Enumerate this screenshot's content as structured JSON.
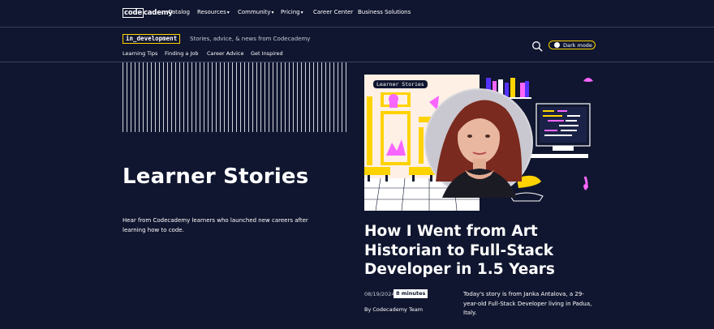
{
  "topnav": {
    "logo_code": "code",
    "logo_cademy": "cademy",
    "items": [
      {
        "label": "Catalog",
        "dropdown": false
      },
      {
        "label": "Resources",
        "dropdown": true
      },
      {
        "label": "Community",
        "dropdown": true
      },
      {
        "label": "Pricing",
        "dropdown": true
      },
      {
        "label": "Career Center",
        "dropdown": false
      },
      {
        "label": "Business Solutions",
        "dropdown": false
      }
    ],
    "caret": "▾"
  },
  "subheader": {
    "brand": "in_development",
    "tagline": "Stories, advice, & news from Codecademy",
    "links": [
      "Learning Tips",
      "Finding a Job",
      "Career Advice",
      "Get Inspired"
    ],
    "dark_mode_label": "Dark mode",
    "search_icon": "search-icon"
  },
  "hero": {
    "title": "Learner Stories",
    "description": "Hear from Codecademy learners who launched new careers after learning how to code."
  },
  "feature": {
    "image_badge": "Learner Stories",
    "title": "How I Went from Art Historian to Full-Stack Developer in 1.5 Years",
    "date": "08/19/2024",
    "read_time": "8 minutes",
    "author": "By Codecademy Team",
    "summary": "Today's story is from Janka Antalova, a 29-year-old Full-Stack Developer living in Padua, Italy."
  },
  "colors": {
    "background": "#10162f",
    "accent_yellow": "#ffd300",
    "accent_pink": "#f966ff",
    "accent_purple": "#5533ff",
    "cream": "#fff0e5"
  }
}
